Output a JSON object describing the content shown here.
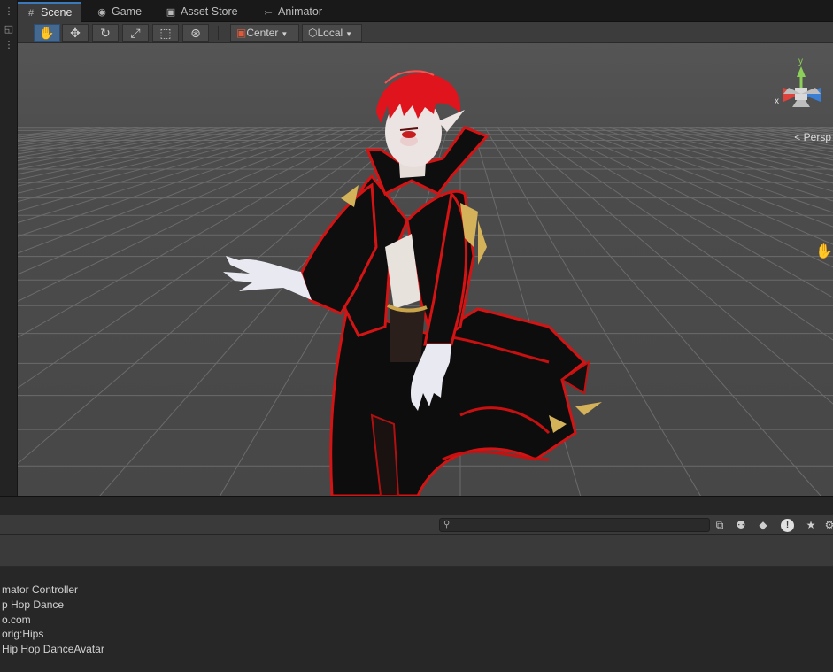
{
  "tabs": [
    {
      "label": "Scene",
      "icon": "grid-icon",
      "active": true
    },
    {
      "label": "Game",
      "icon": "gamepad-icon",
      "active": false
    },
    {
      "label": "Asset Store",
      "icon": "shopping-bag-icon",
      "active": false
    },
    {
      "label": "Animator",
      "icon": "animator-icon",
      "active": false
    }
  ],
  "toolbar": {
    "tools": [
      "hand-tool-icon",
      "move-tool-icon",
      "rotate-tool-icon",
      "scale-tool-icon",
      "rect-tool-icon",
      "transform-tool-icon"
    ],
    "active_tool": "hand-tool-icon",
    "pivot_label": "Center",
    "space_label": "Local"
  },
  "viewport": {
    "projection_label": "< Persp",
    "gizmo_axes": {
      "x": "x",
      "y": "y"
    },
    "colors": {
      "background": "#4d4d4d",
      "grid": "#6a6a6a",
      "x_axis": "#e0413a",
      "y_axis": "#8cd05a",
      "z_axis": "#3a7ed6",
      "character_red": "#e01818"
    }
  },
  "console": {
    "search_placeholder": "",
    "icons": [
      "scene-view-icon",
      "hierarchy-icon",
      "tag-icon",
      "info-icon",
      "star-icon",
      "gear-icon"
    ]
  },
  "info_lines": [
    "mator Controller",
    "p Hop Dance",
    "o.com",
    "orig:Hips",
    "Hip Hop DanceAvatar"
  ]
}
